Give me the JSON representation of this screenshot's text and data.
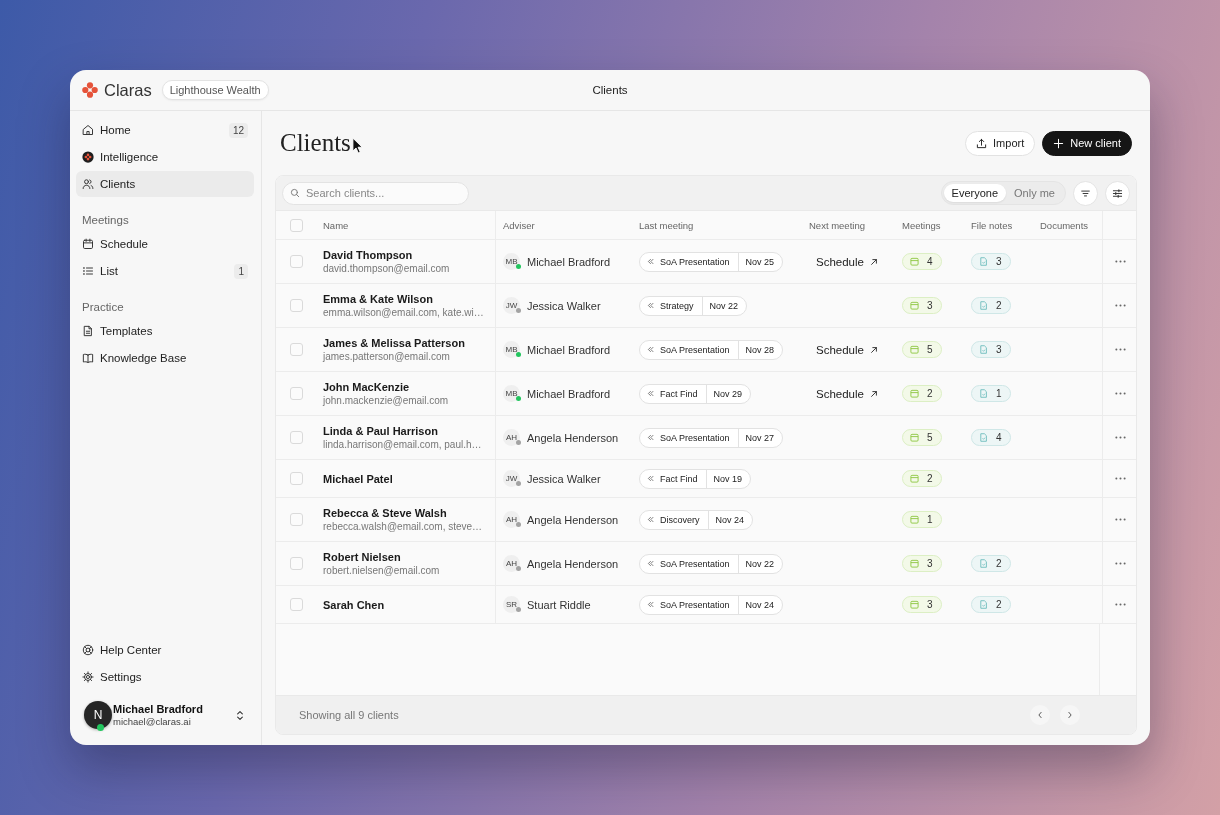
{
  "topbar": {
    "brand": "Claras",
    "workspace": "Lighthouse Wealth",
    "title": "Clients"
  },
  "sidebar": {
    "groups": [
      {
        "items": [
          {
            "label": "Home",
            "badge": "12",
            "selected": false
          },
          {
            "label": "Intelligence",
            "selected": false
          },
          {
            "label": "Clients",
            "selected": true
          }
        ]
      },
      {
        "heading": "Meetings",
        "items": [
          {
            "label": "Schedule",
            "selected": false
          },
          {
            "label": "List",
            "badge": "1",
            "selected": false
          }
        ]
      },
      {
        "heading": "Practice",
        "items": [
          {
            "label": "Templates",
            "selected": false
          },
          {
            "label": "Knowledge Base",
            "selected": false
          }
        ]
      }
    ],
    "footer_items": [
      "Help Center",
      "Settings"
    ],
    "user": {
      "initial": "N",
      "name": "Michael Bradford",
      "email": "michael@claras.ai",
      "online": true
    }
  },
  "page": {
    "title": "Clients",
    "actions": [
      {
        "label": "Import",
        "kind": "secondary"
      },
      {
        "label": "New client",
        "kind": "primary"
      }
    ]
  },
  "toolbar": {
    "search": {
      "placeholder": "Search clients..."
    },
    "scope": [
      {
        "label": "Everyone",
        "selected": true
      },
      {
        "label": "Only me",
        "selected": false
      }
    ]
  },
  "table": {
    "all_checked": false,
    "columns": [
      "Name",
      "Adviser",
      "Last meeting",
      "Next meeting",
      "Meetings",
      "File notes",
      "Documents"
    ],
    "rows": [
      {
        "checked": false,
        "name": "David Thompson",
        "email": "david.thompson@email.com",
        "adviser": {
          "initials": "MB",
          "name": "Michael Bradford",
          "color": "#22c55e"
        },
        "last_meeting": {
          "type": "SoA Presentation",
          "date": "Nov 25"
        },
        "next_meeting": "Schedule",
        "meetings": "4",
        "file_notes": "3"
      },
      {
        "checked": false,
        "name": "Emma & Kate Wilson",
        "email": "emma.wilson@email.com, kate.wi…",
        "adviser": {
          "initials": "JW",
          "name": "Jessica Walker",
          "color": "#a3a3a3"
        },
        "last_meeting": {
          "type": "Strategy",
          "date": "Nov 22"
        },
        "meetings": "3",
        "file_notes": "2"
      },
      {
        "checked": false,
        "name": "James & Melissa Patterson",
        "email": "james.patterson@email.com",
        "adviser": {
          "initials": "MB",
          "name": "Michael Bradford",
          "color": "#22c55e"
        },
        "last_meeting": {
          "type": "SoA Presentation",
          "date": "Nov 28"
        },
        "next_meeting": "Schedule",
        "meetings": "5",
        "file_notes": "3"
      },
      {
        "checked": false,
        "name": "John MacKenzie",
        "email": "john.mackenzie@email.com",
        "adviser": {
          "initials": "MB",
          "name": "Michael Bradford",
          "color": "#22c55e"
        },
        "last_meeting": {
          "type": "Fact Find",
          "date": "Nov 29"
        },
        "next_meeting": "Schedule",
        "meetings": "2",
        "file_notes": "1"
      },
      {
        "checked": false,
        "name": "Linda & Paul Harrison",
        "email": "linda.harrison@email.com, paul.h…",
        "adviser": {
          "initials": "AH",
          "name": "Angela Henderson",
          "color": "#a3a3a3"
        },
        "last_meeting": {
          "type": "SoA Presentation",
          "date": "Nov 27"
        },
        "meetings": "5",
        "file_notes": "4"
      },
      {
        "checked": false,
        "name": "Michael Patel",
        "adviser": {
          "initials": "JW",
          "name": "Jessica Walker",
          "color": "#a3a3a3"
        },
        "last_meeting": {
          "type": "Fact Find",
          "date": "Nov 19"
        },
        "meetings": "2"
      },
      {
        "checked": false,
        "name": "Rebecca & Steve Walsh",
        "email": "rebecca.walsh@email.com, steve…",
        "adviser": {
          "initials": "AH",
          "name": "Angela Henderson",
          "color": "#a3a3a3"
        },
        "last_meeting": {
          "type": "Discovery",
          "date": "Nov 24"
        },
        "meetings": "1"
      },
      {
        "checked": false,
        "name": "Robert Nielsen",
        "email": "robert.nielsen@email.com",
        "adviser": {
          "initials": "AH",
          "name": "Angela Henderson",
          "color": "#a3a3a3"
        },
        "last_meeting": {
          "type": "SoA Presentation",
          "date": "Nov 22"
        },
        "meetings": "3",
        "file_notes": "2"
      },
      {
        "checked": false,
        "name": "Sarah Chen",
        "adviser": {
          "initials": "SR",
          "name": "Stuart Riddle",
          "color": "#a3a3a3"
        },
        "last_meeting": {
          "type": "SoA Presentation",
          "date": "Nov 24"
        },
        "meetings": "3",
        "file_notes": "2"
      }
    ]
  },
  "footer": {
    "summary": "Showing all 9 clients"
  }
}
